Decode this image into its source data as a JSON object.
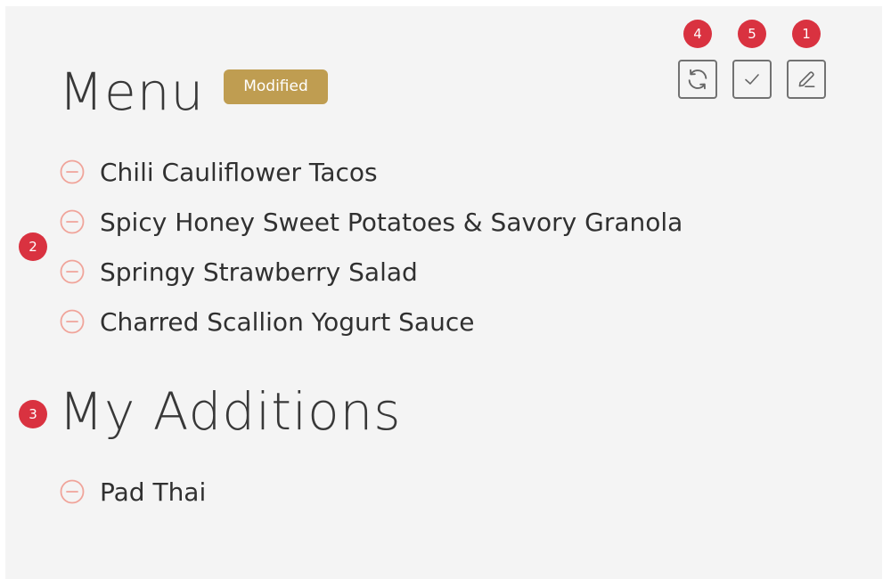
{
  "colors": {
    "badge_bg": "#bf9d51",
    "marker_bg": "#d93240",
    "remove_icon": "#f0a49a",
    "panel_bg": "#f4f4f4"
  },
  "header": {
    "title": "Menu",
    "badge": "Modified",
    "actions": [
      {
        "name": "refresh",
        "icon": "refresh-icon",
        "marker": "4"
      },
      {
        "name": "confirm",
        "icon": "check-icon",
        "marker": "5"
      },
      {
        "name": "edit",
        "icon": "pencil-icon",
        "marker": "1"
      }
    ]
  },
  "menu": {
    "marker": "2",
    "items": [
      {
        "label": "Chili Cauliflower Tacos",
        "icon": "minus-circle-icon"
      },
      {
        "label": "Spicy Honey Sweet Potatoes & Savory Granola",
        "icon": "minus-circle-icon"
      },
      {
        "label": "Springy Strawberry Salad",
        "icon": "minus-circle-icon"
      },
      {
        "label": "Charred Scallion Yogurt Sauce",
        "icon": "minus-circle-icon"
      }
    ]
  },
  "additions": {
    "title": "My Additions",
    "marker": "3",
    "items": [
      {
        "label": "Pad Thai",
        "icon": "minus-circle-icon"
      }
    ]
  }
}
